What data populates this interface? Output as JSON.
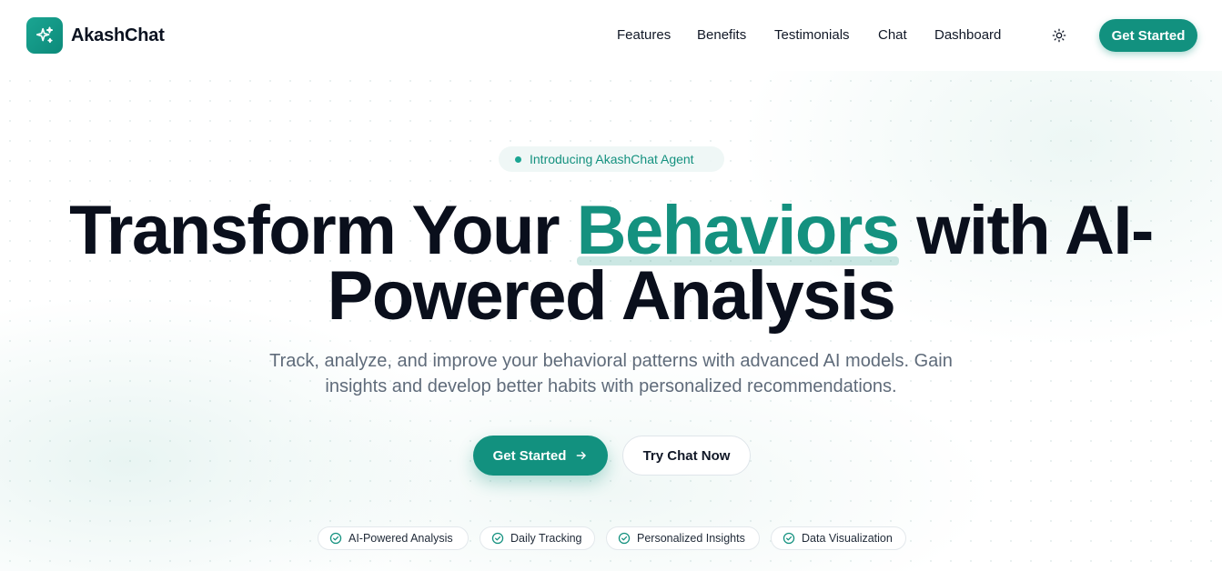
{
  "colors": {
    "brand": "#12917f",
    "highlight": "#14917f",
    "text": "#0a0f1c",
    "muted": "#5f6b7a"
  },
  "nav": {
    "brand_name": "AkashChat",
    "logo_icon": "sparkles-icon",
    "links": [
      "Features",
      "Benefits",
      "Testimonials",
      "Chat",
      "Dashboard"
    ],
    "theme_icon": "sun-icon",
    "cta_label": "Get Started"
  },
  "hero": {
    "badge": "Introducing AkashChat Agent",
    "headline_before": "Transform Your ",
    "headline_highlight": "Behaviors",
    "headline_after_line1": " with AI-",
    "headline_line2": "Powered Analysis",
    "subtitle_line1": "Track, analyze, and improve your behavioral patterns with advanced AI models. Gain",
    "subtitle_line2": "insights and develop better habits with personalized recommendations.",
    "primary_button": "Get Started",
    "primary_button_icon": "arrow-right-icon",
    "secondary_button": "Try Chat Now",
    "features": [
      "AI-Powered Analysis",
      "Daily Tracking",
      "Personalized Insights",
      "Data Visualization"
    ],
    "feature_icon": "check-circle-icon"
  }
}
